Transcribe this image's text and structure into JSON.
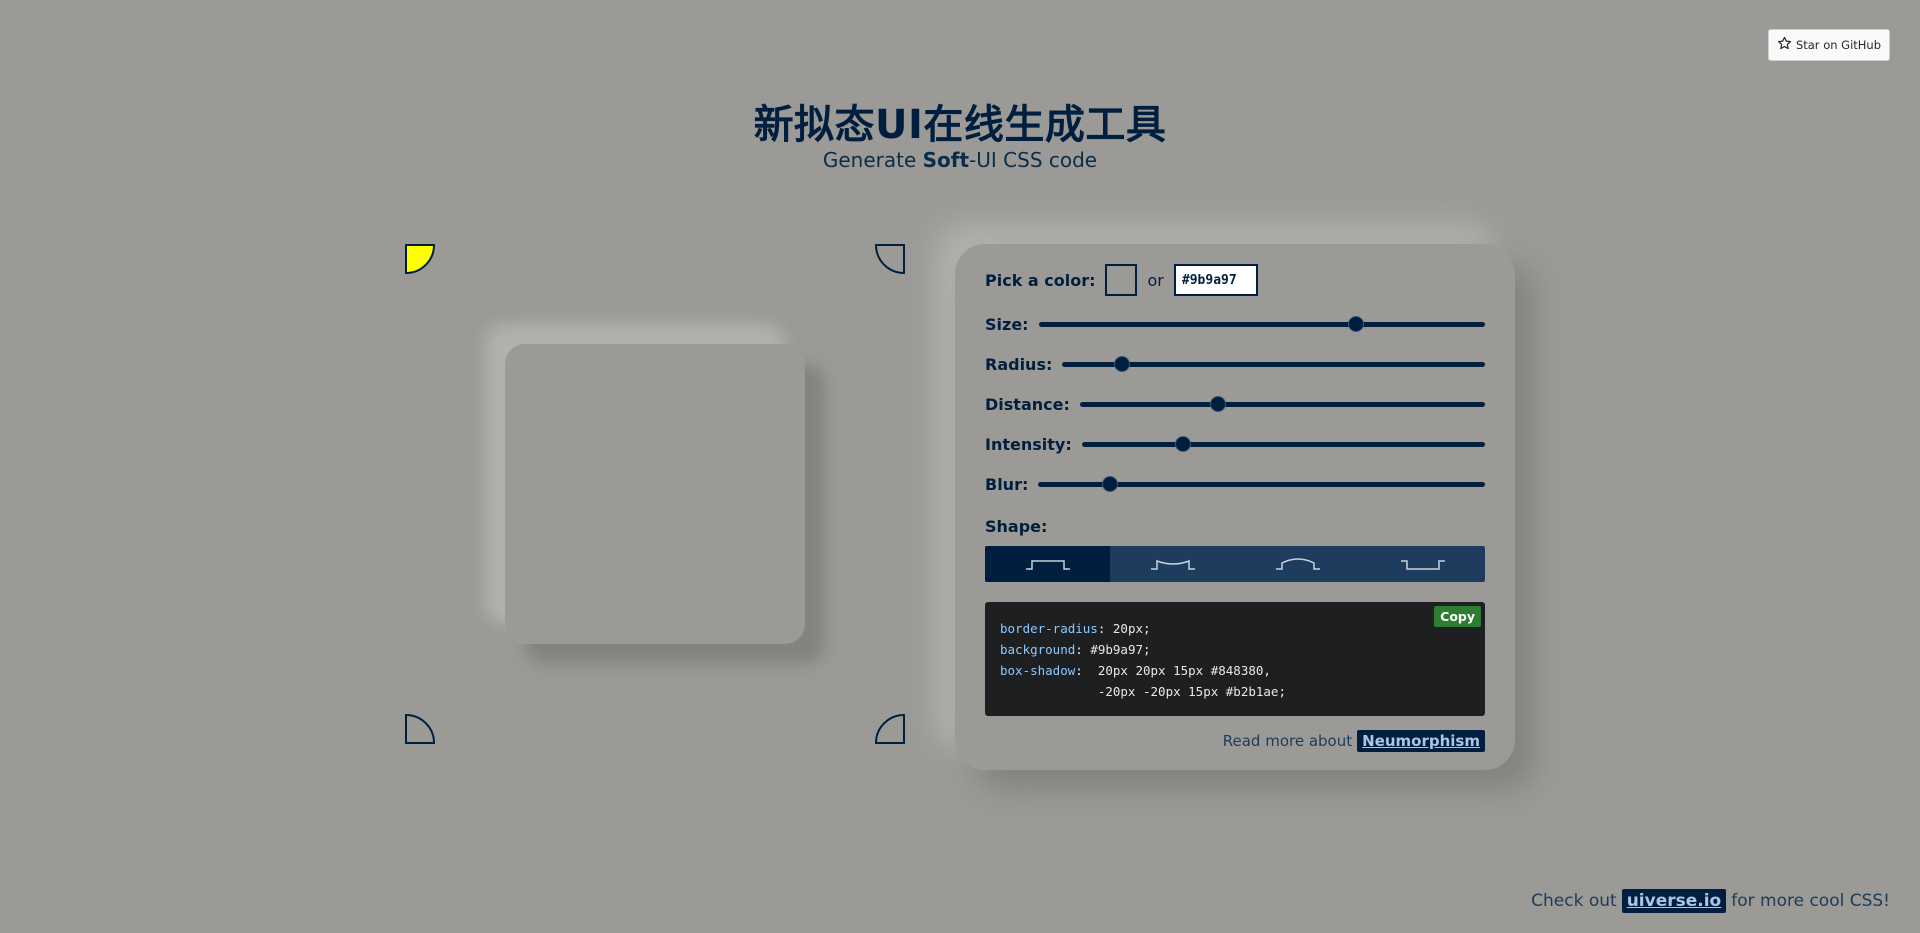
{
  "github": {
    "label": "Star on GitHub",
    "icon": "star-icon"
  },
  "header": {
    "title": "新拟态UI在线生成工具",
    "subtitle_pre": "Generate ",
    "subtitle_bold": "Soft",
    "subtitle_post": "-UI CSS code"
  },
  "controls": {
    "pick_label": "Pick a color:",
    "or_label": "or",
    "hex_value": "#9b9a97",
    "sliders": [
      {
        "label": "Size:",
        "value_pct": 71
      },
      {
        "label": "Radius:",
        "value_pct": 14
      },
      {
        "label": "Distance:",
        "value_pct": 34
      },
      {
        "label": "Intensity:",
        "value_pct": 25
      },
      {
        "label": "Blur:",
        "value_pct": 16
      }
    ],
    "shape_label": "Shape:",
    "shapes": [
      "flat",
      "concave",
      "convex",
      "pressed"
    ],
    "active_shape": 0
  },
  "code": {
    "copy_label": "Copy",
    "lines": [
      {
        "prop": "border-radius",
        "value": ": 20px;"
      },
      {
        "prop": "background",
        "value": ": #9b9a97;"
      },
      {
        "prop": "box-shadow",
        "value": ":  20px 20px 15px #848380,"
      },
      {
        "prop": "",
        "value": "             -20px -20px 15px #b2b1ae;"
      }
    ]
  },
  "readmore": {
    "text": "Read more about ",
    "link": "Neumorphism"
  },
  "footer": {
    "pre": "Check out ",
    "link": "uiverse.io",
    "post": " for more cool CSS!"
  },
  "colors": {
    "background": "#9b9a97",
    "accent": "#001f3f",
    "active_corner": "#ffff00",
    "shadow_dark": "#848380",
    "shadow_light": "#b2b1ae",
    "copy_button": "#2e7d32"
  }
}
